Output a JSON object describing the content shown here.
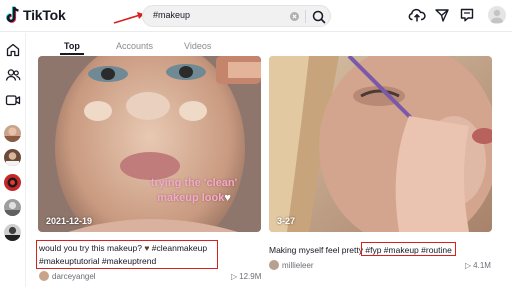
{
  "header": {
    "logo_text": "TikTok",
    "search": {
      "value": "#makeup"
    }
  },
  "tabs": [
    {
      "label": "Top",
      "active": true
    },
    {
      "label": "Accounts",
      "active": false
    },
    {
      "label": "Videos",
      "active": false
    }
  ],
  "videos": [
    {
      "date_badge": "2021-12-19",
      "overlay_text_line1": "trying the 'clean'",
      "overlay_text_line2": "makeup look",
      "caption_line1": "would you try this makeup? ",
      "caption_tags_line1": "#cleanmakeup",
      "caption_line2": "#makeuptutorial #makeuptrend",
      "author": "darceyangel",
      "views": "12.9M"
    },
    {
      "date_badge": "3-27",
      "caption_text": "Making myself feel pretty ",
      "caption_tags": "#fyp #makeup #routine",
      "author": "millieleer",
      "views": "4.1M"
    }
  ],
  "colors": {
    "highlight": "#d8201c",
    "text_primary": "#161823",
    "text_secondary": "#8a8b91"
  }
}
